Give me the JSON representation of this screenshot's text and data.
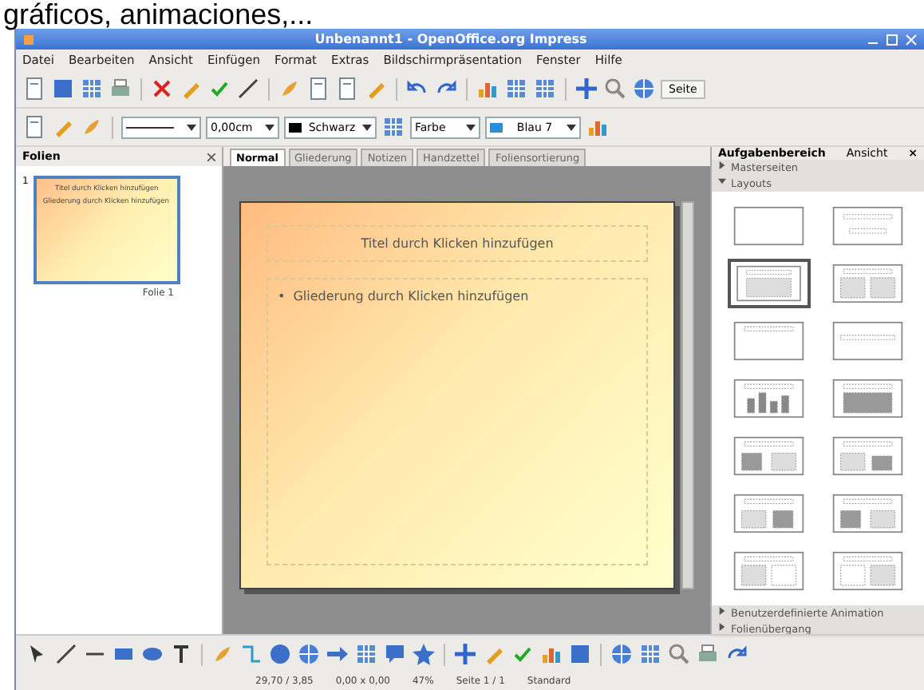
{
  "caption": "gráficos, animaciones,...",
  "window": {
    "title": "Unbenannt1 - OpenOffice.org Impress"
  },
  "menu": [
    "Datei",
    "Bearbeiten",
    "Ansicht",
    "Einfügen",
    "Format",
    "Extras",
    "Bildschirmpräsentation",
    "Fenster",
    "Hilfe"
  ],
  "toolbar": [
    {
      "kind": "doc"
    },
    {
      "kind": "disk"
    },
    {
      "kind": "grid"
    },
    {
      "kind": "printer"
    },
    {
      "kind": "sep"
    },
    {
      "kind": "scissors"
    },
    {
      "kind": "pen"
    },
    {
      "kind": "check"
    },
    {
      "kind": "line"
    },
    {
      "kind": "sep"
    },
    {
      "kind": "brush"
    },
    {
      "kind": "doc"
    },
    {
      "kind": "doc"
    },
    {
      "kind": "pen"
    },
    {
      "kind": "sep"
    },
    {
      "kind": "undo"
    },
    {
      "kind": "redo"
    },
    {
      "kind": "sep"
    },
    {
      "kind": "chart"
    },
    {
      "kind": "grid"
    },
    {
      "kind": "grid"
    },
    {
      "kind": "sep"
    },
    {
      "kind": "cross"
    },
    {
      "kind": "magnifier"
    },
    {
      "kind": "globe"
    }
  ],
  "toolbar_button": "Seite",
  "format_bar": {
    "line_width": "0,00cm",
    "line_color": "Schwarz",
    "fill_kind": "Farbe",
    "fill_color": "Blau 7"
  },
  "slides_panel": {
    "title": "Folien",
    "slides": [
      {
        "number": "1",
        "label": "Folie 1",
        "selected": true,
        "title": "Titel durch Klicken hinzufügen",
        "outline": "Gliederung durch Klicken hinzufügen"
      }
    ]
  },
  "view_tabs": [
    {
      "label": "Normal",
      "selected": true
    },
    {
      "label": "Gliederung",
      "selected": false
    },
    {
      "label": "Notizen",
      "selected": false
    },
    {
      "label": "Handzettel",
      "selected": false
    },
    {
      "label": "Foliensortierung",
      "selected": false
    }
  ],
  "slide": {
    "title": "Titel durch Klicken hinzufügen",
    "bullet": "•",
    "outline": "Gliederung durch Klicken hinzufügen"
  },
  "task_pane": {
    "title": "Aufgabenbereich",
    "view": "Ansicht",
    "close": "×",
    "sections": [
      {
        "label": "Masterseiten",
        "expanded": false
      },
      {
        "label": "Layouts",
        "expanded": true
      }
    ],
    "layouts": [
      {
        "kind": "blank",
        "selected": false
      },
      {
        "kind": "title",
        "selected": false
      },
      {
        "kind": "title-content",
        "selected": true
      },
      {
        "kind": "two-col",
        "selected": false
      },
      {
        "kind": "title-only",
        "selected": false
      },
      {
        "kind": "centered",
        "selected": false
      },
      {
        "kind": "chart",
        "selected": false
      },
      {
        "kind": "table",
        "selected": false
      },
      {
        "kind": "clip-text",
        "selected": false
      },
      {
        "kind": "text-chart",
        "selected": false
      },
      {
        "kind": "text-clip",
        "selected": false
      },
      {
        "kind": "chart-text",
        "selected": false
      },
      {
        "kind": "text-obj",
        "selected": false
      },
      {
        "kind": "obj-text",
        "selected": false
      }
    ],
    "footer_sections": [
      {
        "label": "Benutzerdefinierte Animation",
        "expanded": false
      },
      {
        "label": "Folienübergang",
        "expanded": false
      }
    ]
  },
  "drawbar": [
    {
      "kind": "select"
    },
    {
      "kind": "line"
    },
    {
      "kind": "dash"
    },
    {
      "kind": "rect"
    },
    {
      "kind": "ellipse"
    },
    {
      "kind": "text"
    },
    {
      "kind": "sep"
    },
    {
      "kind": "brush"
    },
    {
      "kind": "connector"
    },
    {
      "kind": "circle"
    },
    {
      "kind": "globe"
    },
    {
      "kind": "arrow"
    },
    {
      "kind": "grid"
    },
    {
      "kind": "bubble"
    },
    {
      "kind": "star"
    },
    {
      "kind": "sep"
    },
    {
      "kind": "cross"
    },
    {
      "kind": "pen"
    },
    {
      "kind": "check"
    },
    {
      "kind": "chart"
    },
    {
      "kind": "disk"
    },
    {
      "kind": "sep"
    },
    {
      "kind": "globe"
    },
    {
      "kind": "grid"
    },
    {
      "kind": "magnifier"
    },
    {
      "kind": "printer"
    },
    {
      "kind": "redo"
    }
  ],
  "status": [
    "29,70 / 3,85",
    "0,00 x 0,00",
    "47%",
    "Seite 1 / 1",
    "Standard"
  ]
}
